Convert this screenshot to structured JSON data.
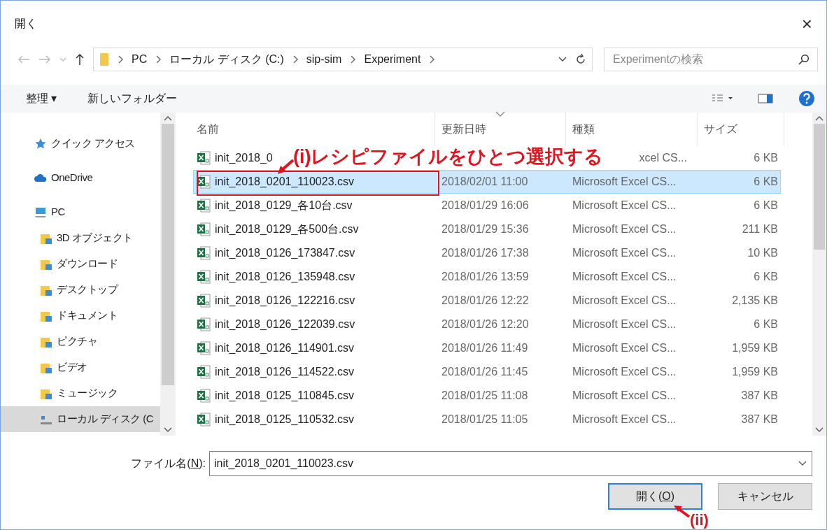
{
  "window": {
    "title": "開く",
    "close": "×"
  },
  "address_bar": {
    "path": [
      "PC",
      "ローカル ディスク (C:)",
      "sip-sim",
      "Experiment"
    ],
    "search_placeholder": "Experimentの検索"
  },
  "toolbar": {
    "organize": "整理 ▾",
    "new_folder": "新しいフォルダー"
  },
  "sidebar": {
    "items": [
      {
        "label": "クイック アクセス",
        "kind": "star",
        "selected": false
      },
      {
        "label": "OneDrive",
        "kind": "cloud",
        "selected": false
      },
      {
        "label": "PC",
        "kind": "pc",
        "selected": false,
        "children": [
          {
            "label": "3D オブジェクト",
            "kind": "folder",
            "selected": false
          },
          {
            "label": "ダウンロード",
            "kind": "folder",
            "selected": false
          },
          {
            "label": "デスクトップ",
            "kind": "folder",
            "selected": false
          },
          {
            "label": "ドキュメント",
            "kind": "folder",
            "selected": false
          },
          {
            "label": "ピクチャ",
            "kind": "folder",
            "selected": false
          },
          {
            "label": "ビデオ",
            "kind": "folder",
            "selected": false
          },
          {
            "label": "ミュージック",
            "kind": "folder",
            "selected": false
          },
          {
            "label": "ローカル ディスク (C",
            "kind": "drive",
            "selected": true
          }
        ]
      }
    ]
  },
  "table": {
    "columns": [
      "名前",
      "更新日時",
      "種類",
      "サイズ"
    ],
    "rows": [
      {
        "name": "init_2018_0",
        "type": "xcel CS...",
        "size": "6 KB",
        "selected": false
      },
      {
        "name": "init_2018_0201_110023.csv",
        "date": "2018/02/01 11:00",
        "type": "Microsoft Excel CS...",
        "size": "6 KB",
        "selected": true
      },
      {
        "name": "init_2018_0129_各10台.csv",
        "date": "2018/01/29 16:06",
        "type": "Microsoft Excel CS...",
        "size": "6 KB",
        "selected": false
      },
      {
        "name": "init_2018_0129_各500台.csv",
        "date": "2018/01/29 15:36",
        "type": "Microsoft Excel CS...",
        "size": "211 KB",
        "selected": false
      },
      {
        "name": "init_2018_0126_173847.csv",
        "date": "2018/01/26 17:38",
        "type": "Microsoft Excel CS...",
        "size": "10 KB",
        "selected": false
      },
      {
        "name": "init_2018_0126_135948.csv",
        "date": "2018/01/26 13:59",
        "type": "Microsoft Excel CS...",
        "size": "6 KB",
        "selected": false
      },
      {
        "name": "init_2018_0126_122216.csv",
        "date": "2018/01/26 12:22",
        "type": "Microsoft Excel CS...",
        "size": "2,135 KB",
        "selected": false
      },
      {
        "name": "init_2018_0126_122039.csv",
        "date": "2018/01/26 12:20",
        "type": "Microsoft Excel CS...",
        "size": "6 KB",
        "selected": false
      },
      {
        "name": "init_2018_0126_114901.csv",
        "date": "2018/01/26 11:49",
        "type": "Microsoft Excel CS...",
        "size": "1,959 KB",
        "selected": false
      },
      {
        "name": "init_2018_0126_114522.csv",
        "date": "2018/01/26 11:45",
        "type": "Microsoft Excel CS...",
        "size": "1,959 KB",
        "selected": false
      },
      {
        "name": "init_2018_0125_110845.csv",
        "date": "2018/01/25 11:08",
        "type": "Microsoft Excel CS...",
        "size": "387 KB",
        "selected": false
      },
      {
        "name": "init_2018_0125_110532.csv",
        "date": "2018/01/25 11:05",
        "type": "Microsoft Excel CS...",
        "size": "387 KB",
        "selected": false
      }
    ]
  },
  "filename": {
    "label_before": "ファイル名(",
    "mnemonic": "N",
    "label_after": "):",
    "value": "init_2018_0201_110023.csv"
  },
  "buttons": [
    {
      "before": "開く(",
      "mnemonic": "O",
      "after": ")",
      "kind": "default"
    },
    {
      "before": "キャンセル",
      "kind": "normal"
    }
  ],
  "annotations": {
    "step1": "(i)レシピファイルをひとつ選択する",
    "step2": "(ii)"
  }
}
